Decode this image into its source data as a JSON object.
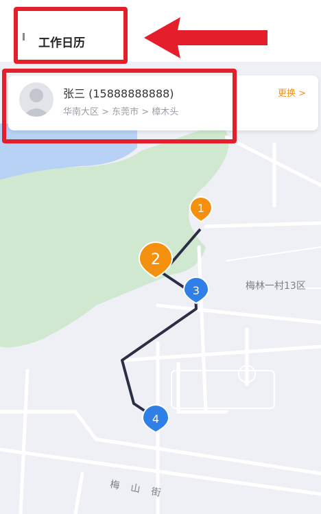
{
  "header": {
    "title": "工作日历"
  },
  "card": {
    "name": "张三 (15888888888)",
    "region": "华南大区 > 东莞市 > 樟木头",
    "change_label": "更换 >"
  },
  "map": {
    "street_label": "梅林一村13区",
    "road_label": "梅 山 街"
  },
  "route": {
    "stops": [
      {
        "label": "1",
        "color": "#f5900f"
      },
      {
        "label": "2",
        "color": "#f5900f"
      },
      {
        "label": "3",
        "color": "#2f7fe6"
      },
      {
        "label": "4",
        "color": "#2f7fe6"
      }
    ],
    "line_color": "#2a2f45"
  },
  "annotation": {
    "highlight_color": "#e41f2b"
  }
}
